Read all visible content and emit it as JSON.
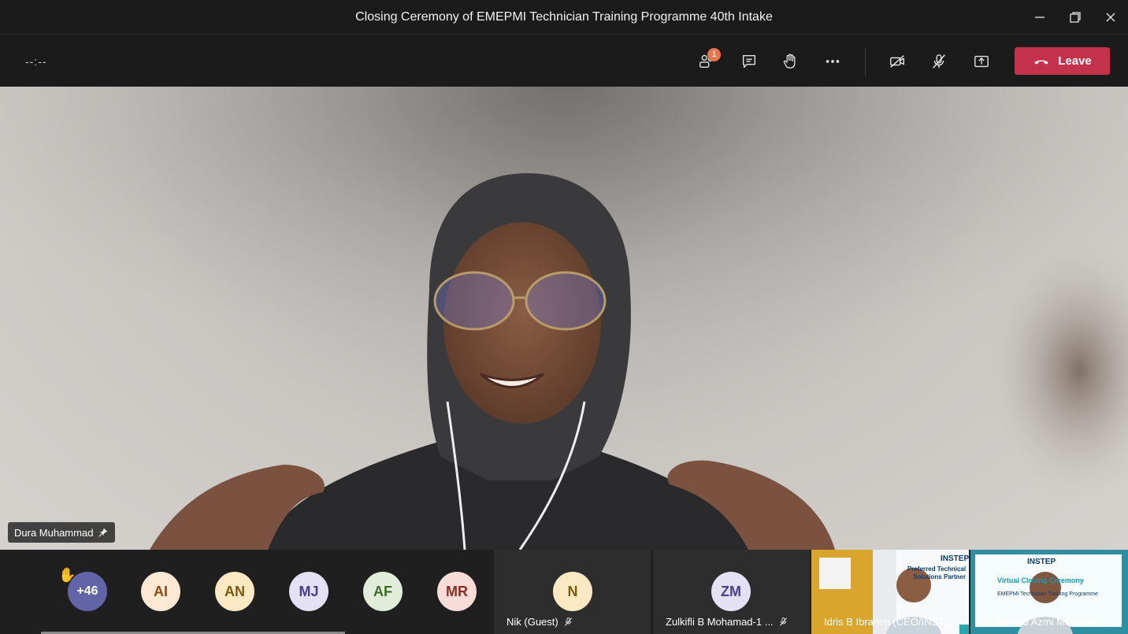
{
  "window": {
    "title": "Closing Ceremony of EMEPMI Technician Training Programme 40th Intake"
  },
  "toolbar": {
    "timer": "--:--",
    "participants_badge": "1",
    "leave_label": "Leave"
  },
  "stage": {
    "speaker_name": "Dura Muhammad"
  },
  "roster": {
    "overflow_count": "+46",
    "avatars": [
      {
        "initials": "AI",
        "bg": "#fde8d4",
        "fg": "#8a4a12"
      },
      {
        "initials": "AN",
        "bg": "#fbe9c4",
        "fg": "#7a5a10"
      },
      {
        "initials": "MJ",
        "bg": "#e4e1f5",
        "fg": "#4a3f88"
      },
      {
        "initials": "AF",
        "bg": "#e1edd9",
        "fg": "#3e6a2a"
      },
      {
        "initials": "MR",
        "bg": "#f7dcd8",
        "fg": "#8a2e24"
      }
    ],
    "tiles": [
      {
        "initials": "N",
        "name": "Nik (Guest)",
        "bg": "#fbe9c4",
        "fg": "#7a5a10"
      },
      {
        "initials": "ZM",
        "name": "Zulkifli B Mohamad-1 ...",
        "bg": "#e4e1f5",
        "fg": "#4a3f88"
      }
    ],
    "videos": [
      {
        "name": "Idris B Ibrahim (CEO/INST...",
        "logo": "INSTEP",
        "line1": "Preferred Technical",
        "line2": "Solutions Partner"
      },
      {
        "name": "Mohamad Azmi Mohama...",
        "logo": "INSTEP",
        "line1": "Virtual Closing Ceremony",
        "line2": "EMEPMI Technician Training Programme"
      }
    ]
  }
}
